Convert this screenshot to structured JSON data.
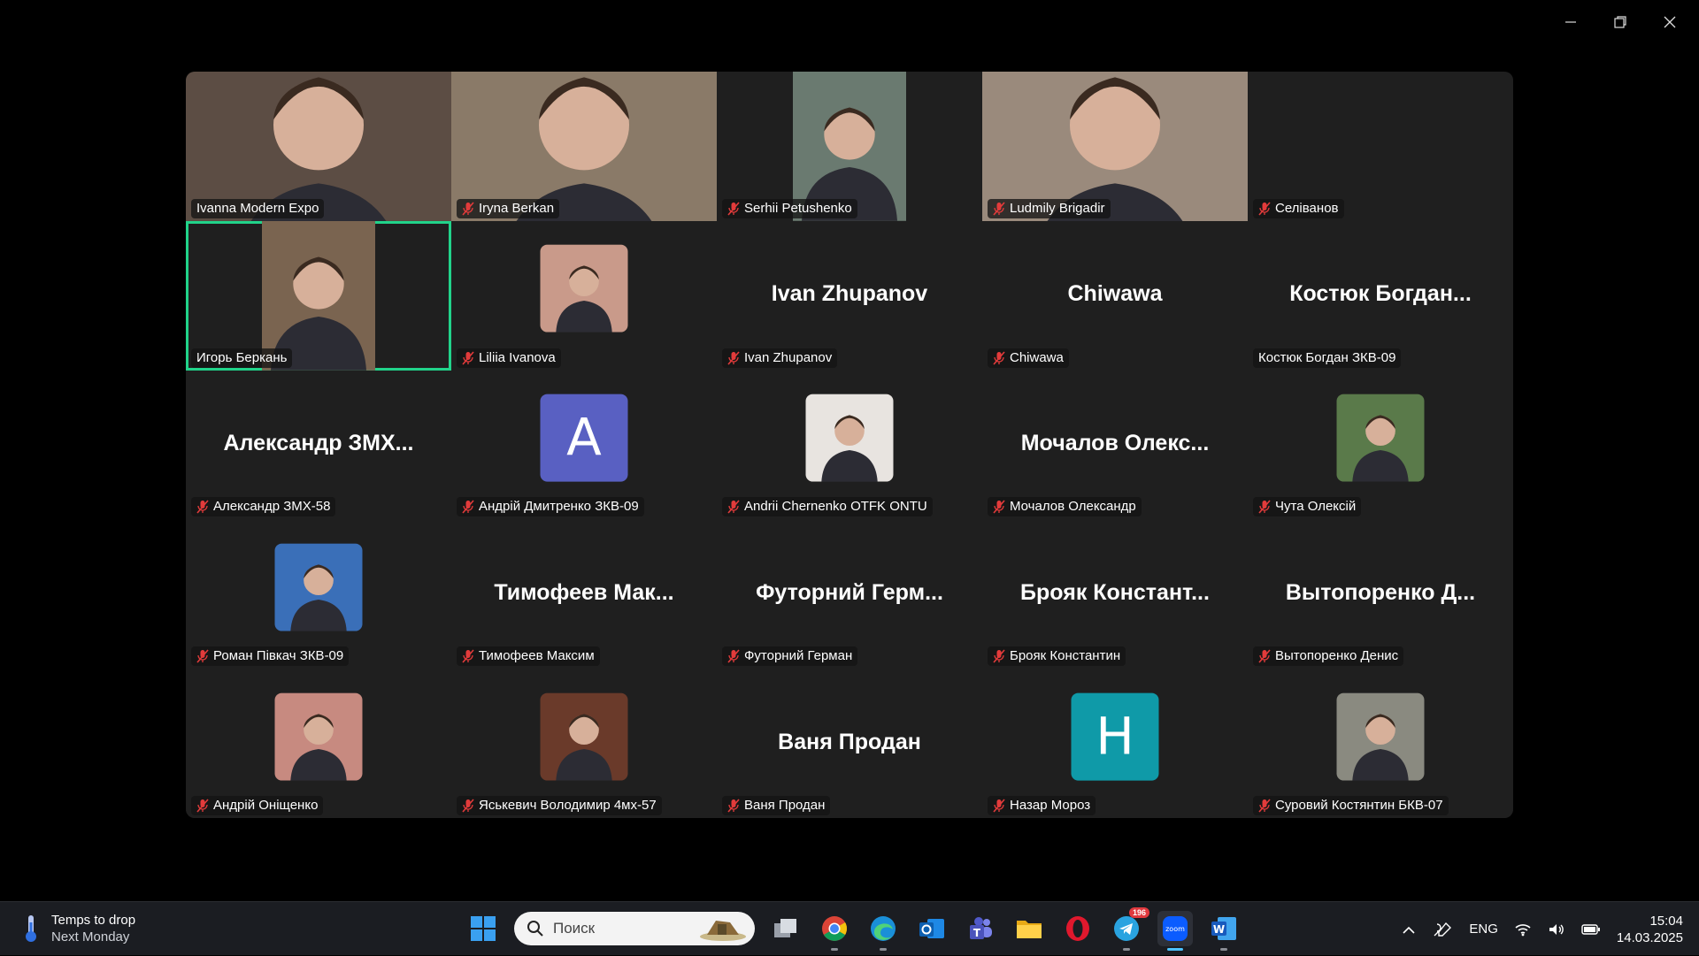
{
  "participants": [
    {
      "label": "Ivanna Modern Expo",
      "muted": false,
      "kind": "video",
      "bg": "#5c4d44"
    },
    {
      "label": "Iryna Berkan",
      "muted": true,
      "kind": "video",
      "bg": "#8a7a68"
    },
    {
      "label": "Serhii Petushenko",
      "muted": true,
      "kind": "video-narrow",
      "bg": "#6a7a70"
    },
    {
      "label": "Ludmily Brigadir",
      "muted": true,
      "kind": "video",
      "bg": "#9a8a7c"
    },
    {
      "label": "Селіванов",
      "muted": true,
      "kind": "blank"
    },
    {
      "label": "Игорь Беркань",
      "muted": false,
      "kind": "video-narrow",
      "bg": "#7a6450",
      "active": true
    },
    {
      "label": "Liliia Ivanova",
      "muted": true,
      "kind": "avatar",
      "bg": "#c99a8a"
    },
    {
      "label": "Ivan Zhupanov",
      "muted": true,
      "kind": "name",
      "big": "Ivan Zhupanov"
    },
    {
      "label": "Chiwawa",
      "muted": true,
      "kind": "name",
      "big": "Chiwawa"
    },
    {
      "label": "Костюк Богдан ЗКВ-09",
      "muted": false,
      "kind": "name",
      "big": "Костюк  Богдан..."
    },
    {
      "label": "Александр ЗМХ-58",
      "muted": true,
      "kind": "name",
      "big": "Александр  ЗМХ..."
    },
    {
      "label": "Андрій Дмитренко ЗКВ-09",
      "muted": true,
      "kind": "letter",
      "letter": "A",
      "bg": "#5960c2"
    },
    {
      "label": "Andrii Chernenko OTFK ONTU",
      "muted": true,
      "kind": "avatar",
      "bg": "#e8e4e0"
    },
    {
      "label": "Мочалов Олександр",
      "muted": true,
      "kind": "name",
      "big": "Мочалов  Олекс..."
    },
    {
      "label": "Чута Олексій",
      "muted": true,
      "kind": "avatar",
      "bg": "#5a7a4a"
    },
    {
      "label": "Роман Півкач ЗКВ-09",
      "muted": true,
      "kind": "avatar",
      "bg": "#3a6fb8"
    },
    {
      "label": "Тимофеев Максим",
      "muted": true,
      "kind": "name",
      "big": "Тимофеев  Мак..."
    },
    {
      "label": "Футорний Герман",
      "muted": true,
      "kind": "name",
      "big": "Футорний  Герм..."
    },
    {
      "label": "Брояк Константин",
      "muted": true,
      "kind": "name",
      "big": "Брояк  Констант..."
    },
    {
      "label": "Вытопоренко Денис",
      "muted": true,
      "kind": "name",
      "big": "Вытопоренко  Д..."
    },
    {
      "label": "Андрій Оніщенко",
      "muted": true,
      "kind": "avatar",
      "bg": "#c78a80"
    },
    {
      "label": "Яськевич Володимир 4мх-57",
      "muted": true,
      "kind": "avatar",
      "bg": "#6a3a2a"
    },
    {
      "label": "Ваня Продан",
      "muted": true,
      "kind": "name",
      "big": "Ваня Продан"
    },
    {
      "label": "Назар Мороз",
      "muted": true,
      "kind": "letter",
      "letter": "H",
      "bg": "#0f9aa8"
    },
    {
      "label": "Суровий Костянтин БКВ-07",
      "muted": true,
      "kind": "avatar",
      "bg": "#8a8a80"
    }
  ],
  "taskbar": {
    "weather_title": "Temps to drop",
    "weather_sub": "Next Monday",
    "search_placeholder": "Поиск",
    "telegram_badge": "196",
    "language": "ENG",
    "time": "15:04",
    "date": "14.03.2025"
  },
  "colors": {
    "active_speaker": "#21d38a",
    "grid_bg": "#1f1f1f",
    "accent": "#4cc2ff"
  }
}
